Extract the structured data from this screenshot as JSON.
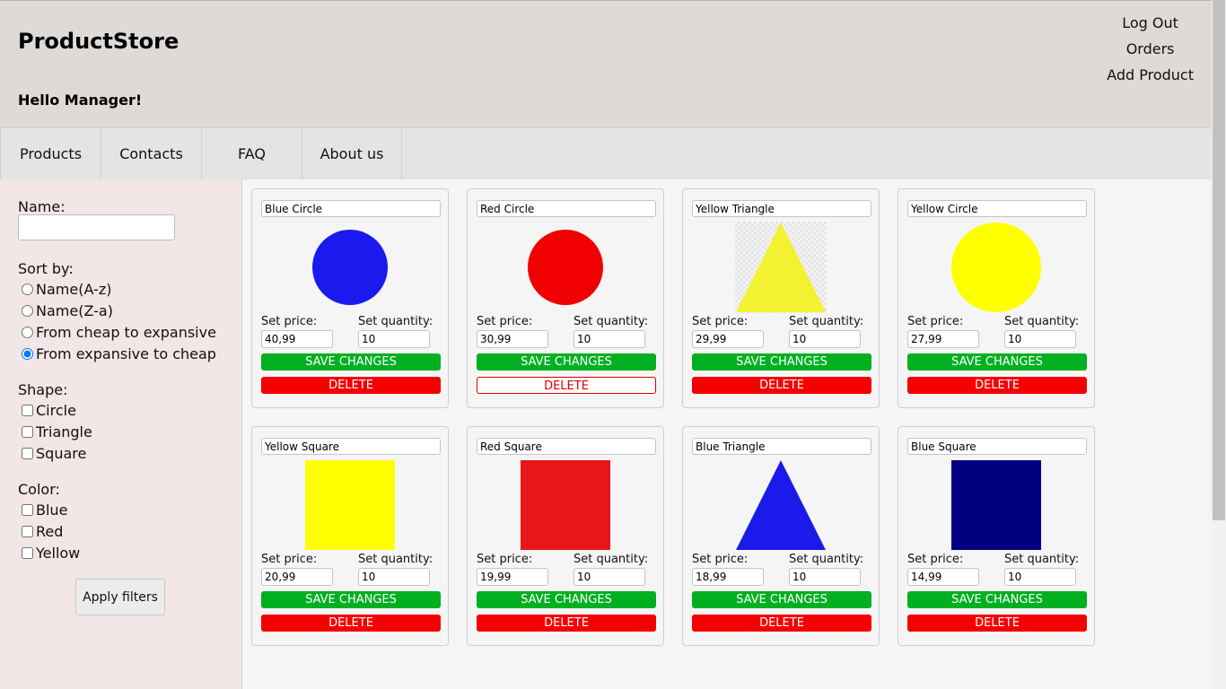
{
  "header": {
    "brand": "ProductStore",
    "greeting": "Hello Manager!",
    "links": [
      "Log Out",
      "Orders",
      "Add Product"
    ]
  },
  "nav": {
    "items": [
      "Products",
      "Contacts",
      "FAQ",
      "About us"
    ]
  },
  "sidebar": {
    "name_label": "Name:",
    "name_value": "",
    "sort_label": "Sort by:",
    "sort_options": [
      "Name(A-z)",
      "Name(Z-a)",
      "From cheap to expansive",
      "From expansive to cheap"
    ],
    "sort_selected": "From expansive to cheap",
    "shape_label": "Shape:",
    "shapes": [
      "Circle",
      "Triangle",
      "Square"
    ],
    "color_label": "Color:",
    "colors": [
      "Blue",
      "Red",
      "Yellow"
    ],
    "apply_label": "Apply filters"
  },
  "card_labels": {
    "price": "Set price:",
    "quantity": "Set quantity:",
    "save": "SAVE CHANGES",
    "delete": "DELETE"
  },
  "products": [
    {
      "name": "Blue Circle",
      "shape": "circle",
      "color": "#1a1aef",
      "price": "40,99",
      "quantity": "10"
    },
    {
      "name": "Red Circle",
      "shape": "circle",
      "color": "#f00000",
      "price": "30,99",
      "quantity": "10",
      "delete_style": "outlined"
    },
    {
      "name": "Yellow Triangle",
      "shape": "triangle",
      "color": "#f2f230",
      "price": "29,99",
      "quantity": "10",
      "checkered": true
    },
    {
      "name": "Yellow Circle",
      "shape": "circle",
      "color": "#ffff00",
      "price": "27,99",
      "quantity": "10"
    },
    {
      "name": "Yellow Square",
      "shape": "square",
      "color": "#ffff00",
      "price": "20,99",
      "quantity": "10"
    },
    {
      "name": "Red Square",
      "shape": "square",
      "color": "#e8161b",
      "price": "19,99",
      "quantity": "10"
    },
    {
      "name": "Blue Triangle",
      "shape": "triangle",
      "color": "#1a1aea",
      "price": "18,99",
      "quantity": "10"
    },
    {
      "name": "Blue Square",
      "shape": "square",
      "color": "#00007f",
      "price": "14,99",
      "quantity": "10"
    }
  ]
}
